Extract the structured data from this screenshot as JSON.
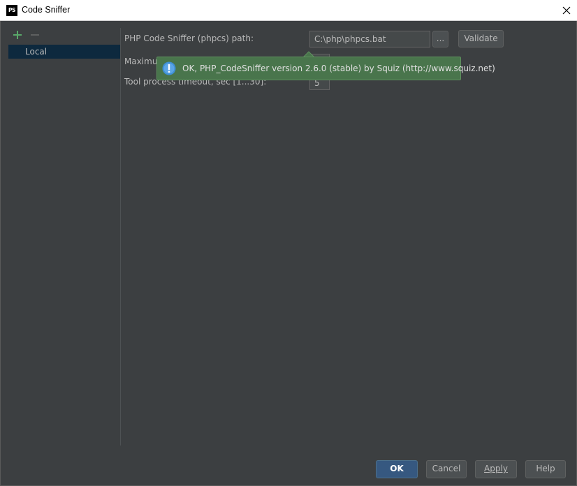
{
  "window": {
    "title": "Code Sniffer",
    "app_icon_text": "PS"
  },
  "sidebar": {
    "items": [
      {
        "label": "Local",
        "selected": true
      }
    ]
  },
  "form": {
    "path_label": "PHP Code Sniffer (phpcs) path:",
    "path_value": "C:\\php\\phpcs.bat",
    "browse_label": "...",
    "validate_label": "Validate",
    "max_messages_label_visible": "Maximu",
    "timeout_label": "Tool process timeout, sec [1...30]:",
    "timeout_value": "5"
  },
  "tooltip": {
    "message": "OK, PHP_CodeSniffer version 2.6.0 (stable) by Squiz (http://www.squiz.net)"
  },
  "footer": {
    "ok_label": "OK",
    "cancel_label": "Cancel",
    "apply_label": "Apply",
    "help_label": "Help"
  },
  "colors": {
    "add_icon": "#59a869",
    "tooltip_bg": "#49754c",
    "selection": "#0d293e"
  }
}
